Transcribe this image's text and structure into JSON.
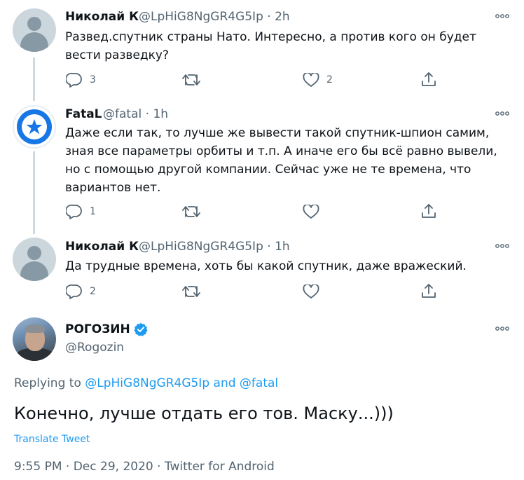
{
  "tweets": [
    {
      "name": "Николай К",
      "handle": "@LpHiG8NgGR4G5Ip",
      "sep": "·",
      "time": "2h",
      "text": "Развед.спутник страны Нато. Интересно, а против кого он будет вести разведку?",
      "reply_count": "3",
      "retweet_count": "",
      "like_count": "2"
    },
    {
      "name": "FataL",
      "handle": "@fatal",
      "sep": "·",
      "time": "1h",
      "text": "Даже если так, то лучше же вывести такой спутник-шпион самим, зная все параметры орбиты и т.п. А иначе его бы всё равно вывели, но с помощью другой компании. Сейчас уже не те времена, что вариантов нет.",
      "reply_count": "1",
      "retweet_count": "",
      "like_count": ""
    },
    {
      "name": "Николай К",
      "handle": "@LpHiG8NgGR4G5Ip",
      "sep": "·",
      "time": "1h",
      "text": "Да трудные времена, хоть бы какой спутник, даже вражеский.",
      "reply_count": "2",
      "retweet_count": "",
      "like_count": ""
    }
  ],
  "main_tweet": {
    "name": "РОГОЗИН",
    "handle": "@Rogozin",
    "replying_prefix": "Replying to",
    "replying_user1": "@LpHiG8NgGR4G5Ip",
    "replying_and": "and",
    "replying_user2": "@fatal",
    "text": "Конечно, лучше отдать его тов. Маску...)))",
    "translate": "Translate Tweet",
    "timestamp": "9:55 PM · Dec 29, 2020 · Twitter for Android"
  },
  "icons": {
    "more": "more-horizontal-icon",
    "reply": "reply-icon",
    "retweet": "retweet-icon",
    "like": "heart-icon",
    "share": "share-icon",
    "verified": "verified-badge-icon"
  },
  "colors": {
    "accent": "#1d9bf0",
    "secondary_text": "#536471",
    "thread_line": "#cfd9de",
    "verified": "#1d9bf0"
  }
}
